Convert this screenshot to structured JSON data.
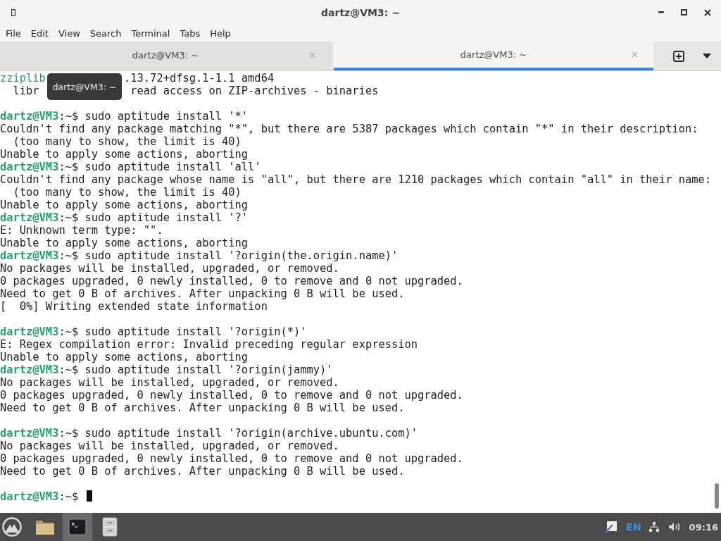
{
  "window": {
    "title": "dartz@VM3: ~"
  },
  "menu": [
    "File",
    "Edit",
    "View",
    "Search",
    "Terminal",
    "Tabs",
    "Help"
  ],
  "tabs": [
    {
      "label": "dartz@VM3: ~",
      "selected": false
    },
    {
      "label": "dartz@VM3: ~",
      "selected": true
    }
  ],
  "tooltip": "dartz@VM3: ~",
  "lines": [
    {
      "kind": "covered",
      "parts": [
        {
          "kind": "package",
          "text": "zziplib"
        },
        {
          "kind": "plain",
          "text": ".13.72+dfsg.1-1.1 amd64"
        }
      ]
    },
    {
      "kind": "covered",
      "parts": [
        {
          "kind": "plain",
          "text": "  libr"
        },
        {
          "kind": "plain",
          "text": " read access on ZIP-archives - binaries"
        }
      ]
    },
    {
      "kind": "blank"
    },
    {
      "kind": "prompt",
      "user": "dartz@VM3",
      "text": ":~$ sudo aptitude install '*'"
    },
    {
      "kind": "output",
      "text": "Couldn't find any package matching \"*\", but there are 5387 packages which contain \"*\" in their description:"
    },
    {
      "kind": "output",
      "text": "  (too many to show, the limit is 40)"
    },
    {
      "kind": "output",
      "text": "Unable to apply some actions, aborting"
    },
    {
      "kind": "prompt",
      "user": "dartz@VM3",
      "text": ":~$ sudo aptitude install 'all'"
    },
    {
      "kind": "output",
      "text": "Couldn't find any package whose name is \"all\", but there are 1210 packages which contain \"all\" in their name:"
    },
    {
      "kind": "output",
      "text": "  (too many to show, the limit is 40)"
    },
    {
      "kind": "output",
      "text": "Unable to apply some actions, aborting"
    },
    {
      "kind": "prompt",
      "user": "dartz@VM3",
      "text": ":~$ sudo aptitude install '?'"
    },
    {
      "kind": "output",
      "text": "E: Unknown term type: \"\"."
    },
    {
      "kind": "output",
      "text": "Unable to apply some actions, aborting"
    },
    {
      "kind": "prompt",
      "user": "dartz@VM3",
      "text": ":~$ sudo aptitude install '?origin(the.origin.name)'"
    },
    {
      "kind": "output",
      "text": "No packages will be installed, upgraded, or removed."
    },
    {
      "kind": "output",
      "text": "0 packages upgraded, 0 newly installed, 0 to remove and 0 not upgraded."
    },
    {
      "kind": "output",
      "text": "Need to get 0 B of archives. After unpacking 0 B will be used."
    },
    {
      "kind": "output",
      "text": "[  0%] Writing extended state information"
    },
    {
      "kind": "blank"
    },
    {
      "kind": "prompt",
      "user": "dartz@VM3",
      "text": ":~$ sudo aptitude install '?origin(*)'"
    },
    {
      "kind": "output",
      "text": "E: Regex compilation error: Invalid preceding regular expression"
    },
    {
      "kind": "output",
      "text": "Unable to apply some actions, aborting"
    },
    {
      "kind": "prompt",
      "user": "dartz@VM3",
      "text": ":~$ sudo aptitude install '?origin(jammy)'"
    },
    {
      "kind": "output",
      "text": "No packages will be installed, upgraded, or removed."
    },
    {
      "kind": "output",
      "text": "0 packages upgraded, 0 newly installed, 0 to remove and 0 not upgraded."
    },
    {
      "kind": "output",
      "text": "Need to get 0 B of archives. After unpacking 0 B will be used."
    },
    {
      "kind": "blank"
    },
    {
      "kind": "prompt",
      "user": "dartz@VM3",
      "text": ":~$ sudo aptitude install '?origin(archive.ubuntu.com)'"
    },
    {
      "kind": "output",
      "text": "No packages will be installed, upgraded, or removed."
    },
    {
      "kind": "output",
      "text": "0 packages upgraded, 0 newly installed, 0 to remove and 0 not upgraded."
    },
    {
      "kind": "output",
      "text": "Need to get 0 B of archives. After unpacking 0 B will be used."
    },
    {
      "kind": "blank"
    },
    {
      "kind": "prompt",
      "user": "dartz@VM3",
      "text": ":~$ ",
      "cursor": true
    }
  ],
  "taskbar": {
    "apps": [
      {
        "kind": "folder",
        "selected": false
      },
      {
        "kind": "terminal",
        "selected": true
      },
      {
        "kind": "cabinet",
        "selected": false
      }
    ],
    "language": "EN",
    "clock": "09:16"
  }
}
